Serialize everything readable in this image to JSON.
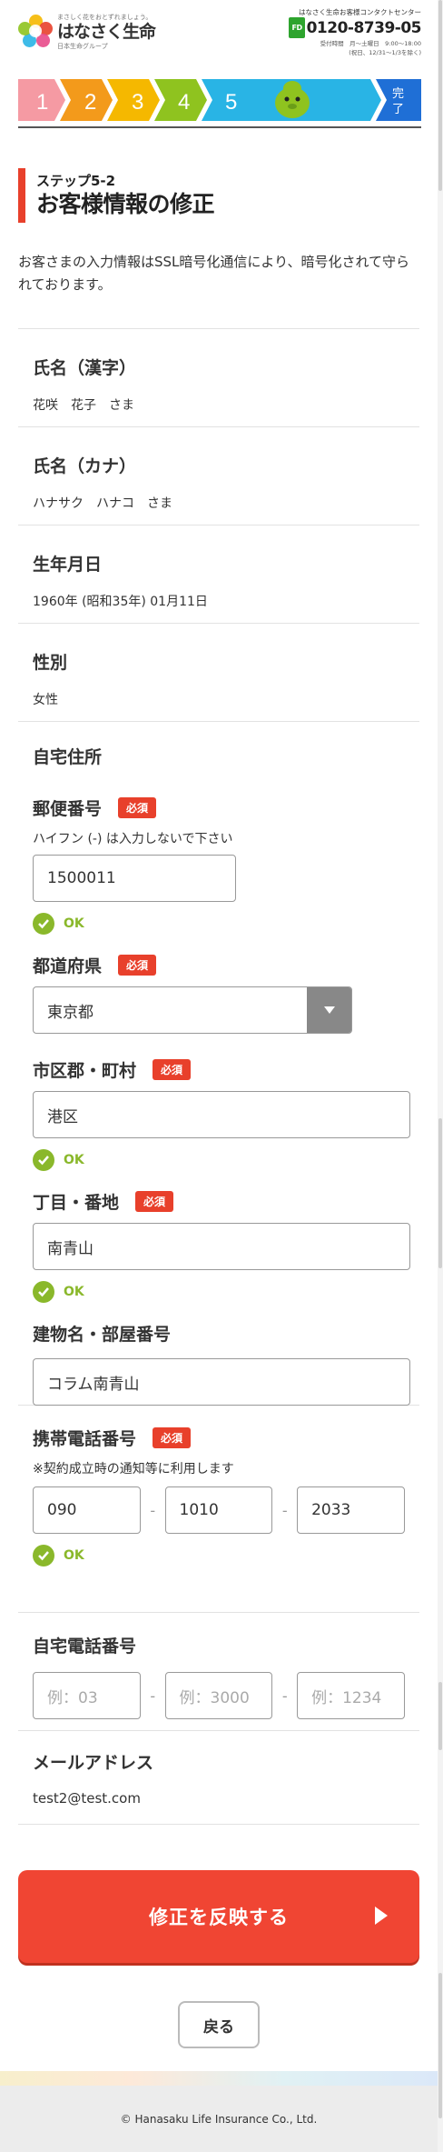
{
  "header": {
    "logo_tagline": "まさしく花をおとずれましょう。",
    "logo_name": "はなさく生命",
    "logo_group": "日本生命グループ",
    "contact_label": "はなさく生命お客様コンタクトセンター",
    "tel_mark": "FD",
    "tel": "0120-8739-05",
    "hours": "受付時間　月～土曜日　9:00～18:00",
    "holiday": "(祝日、12/31～1/3を除く)"
  },
  "steps": {
    "items": [
      "1",
      "2",
      "3",
      "4",
      "5"
    ],
    "complete_label": [
      "完",
      "了"
    ],
    "current": 5,
    "colors": [
      "#f59aa3",
      "#f39a1b",
      "#f5b800",
      "#8fc31f",
      "#29b4e5",
      "#1f6fd6"
    ]
  },
  "page": {
    "step_label": "ステップ5-2",
    "title": "お客様情報の修正",
    "intro": "お客さまの入力情報はSSL暗号化通信により、暗号化されて守られております。"
  },
  "readonly": [
    {
      "label": "氏名（漢字）",
      "value": "花咲　花子　さま"
    },
    {
      "label": "氏名（カナ）",
      "value": "ハナサク　ハナコ　さま"
    },
    {
      "label": "生年月日",
      "value": "1960年 (昭和35年) 01月11日"
    },
    {
      "label": "性別",
      "value": "女性"
    }
  ],
  "address": {
    "heading": "自宅住所",
    "postal": {
      "label": "郵便番号",
      "note": "ハイフン (-) は入力しないで下さい",
      "value": "1500011"
    },
    "prefecture": {
      "label": "都道府県",
      "value": "東京都"
    },
    "city": {
      "label": "市区郡・町村",
      "value": "港区"
    },
    "block": {
      "label": "丁目・番地",
      "value": "南青山"
    },
    "building": {
      "label": "建物名・部屋番号",
      "value": "コラム南青山"
    }
  },
  "mobile": {
    "label": "携帯電話番号",
    "note": "※契約成立時の通知等に利用します",
    "values": [
      "090",
      "1010",
      "2033"
    ]
  },
  "home_phone": {
    "label": "自宅電話番号",
    "placeholders": [
      "例：03",
      "例：3000",
      "例：1234"
    ]
  },
  "email": {
    "label": "メールアドレス",
    "value": "test2@test.com"
  },
  "required_badge": "必須",
  "ok_label": "OK",
  "dash": "-",
  "submit_label": "修正を反映する",
  "back_label": "戻る",
  "footer": {
    "copyright": "© Hanasaku Life Insurance Co., Ltd."
  },
  "colors": {
    "accent": "#e8402b",
    "ok": "#8ab82b",
    "submit": "#f04533"
  }
}
